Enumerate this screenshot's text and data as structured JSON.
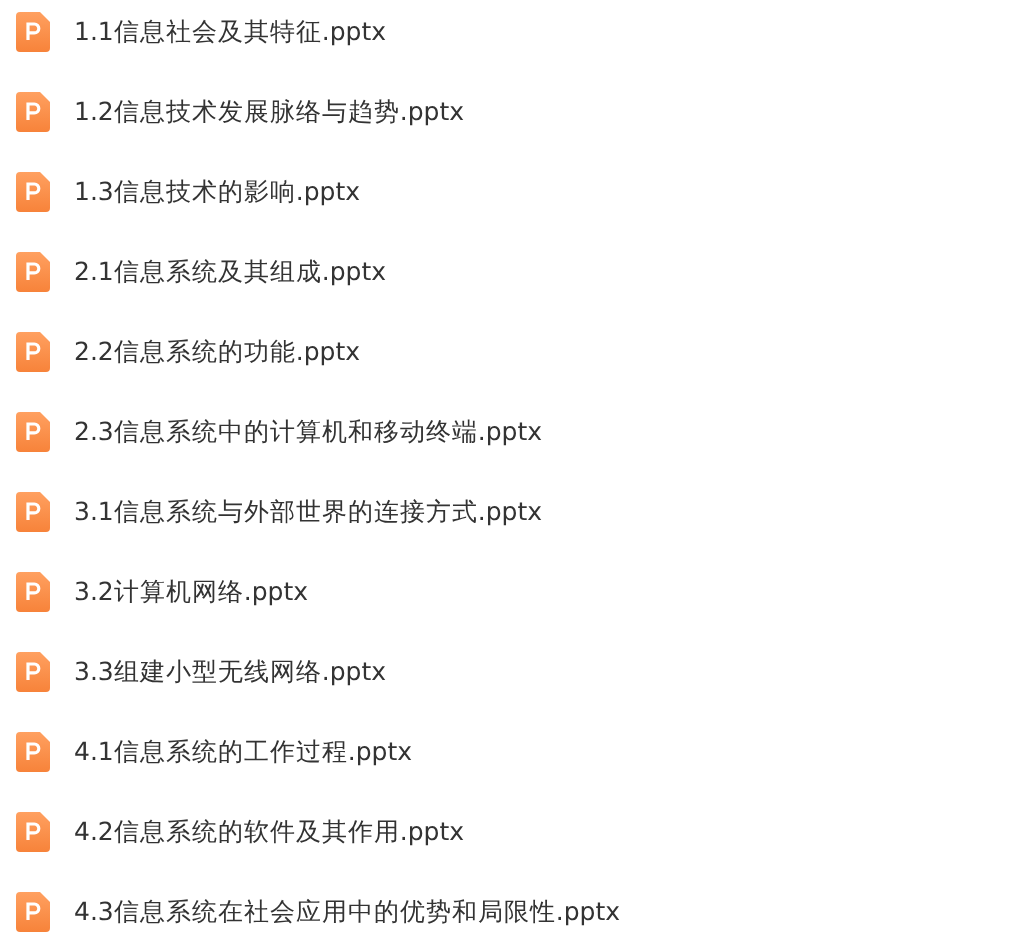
{
  "files": [
    {
      "name": "1.1信息社会及其特征.pptx"
    },
    {
      "name": "1.2信息技术发展脉络与趋势.pptx"
    },
    {
      "name": "1.3信息技术的影响.pptx"
    },
    {
      "name": "2.1信息系统及其组成.pptx"
    },
    {
      "name": "2.2信息系统的功能.pptx"
    },
    {
      "name": "2.3信息系统中的计算机和移动终端.pptx"
    },
    {
      "name": "3.1信息系统与外部世界的连接方式.pptx"
    },
    {
      "name": "3.2计算机网络.pptx"
    },
    {
      "name": "3.3组建小型无线网络.pptx"
    },
    {
      "name": "4.1信息系统的工作过程.pptx"
    },
    {
      "name": "4.2信息系统的软件及其作用.pptx"
    },
    {
      "name": "4.3信息系统在社会应用中的优势和局限性.pptx"
    }
  ]
}
